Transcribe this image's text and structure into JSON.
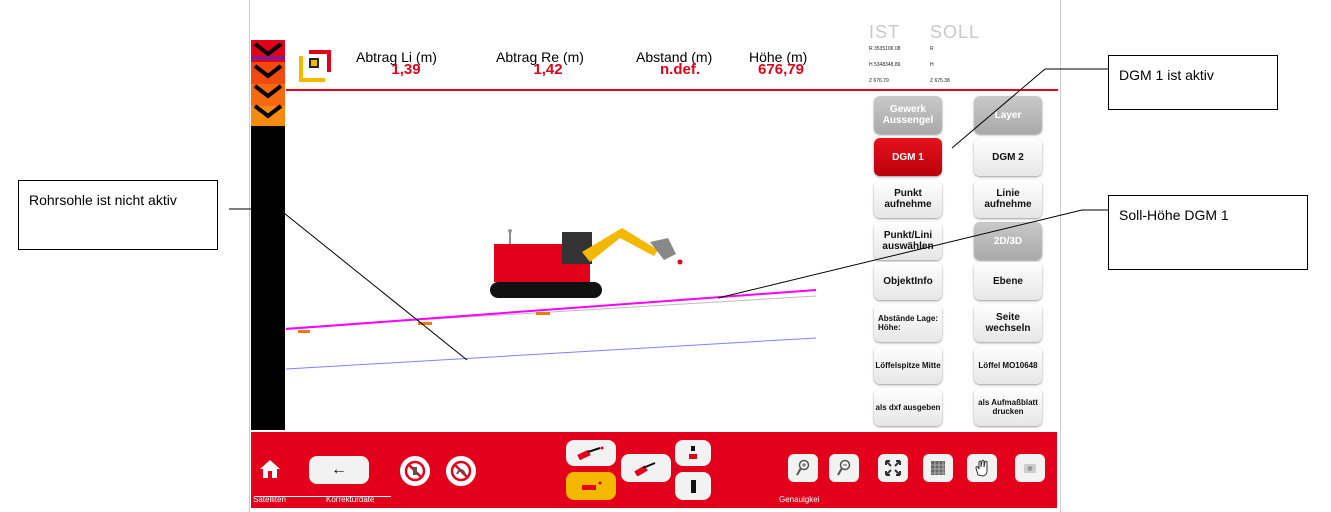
{
  "header": {
    "abtrag_li_label": "Abtrag Li (m)",
    "abtrag_li_value": "1,39",
    "abtrag_re_label": "Abtrag Re (m)",
    "abtrag_re_value": "1,42",
    "abstand_label": "Abstand (m)",
    "abstand_value": "n.def.",
    "hoehe_label": "Höhe (m)",
    "hoehe_value": "676,79"
  },
  "coords": {
    "ist_label": "IST",
    "soll_label": "SOLL",
    "ist_r": "R 3535106.08",
    "ist_h": "H 5348348.89",
    "ist_z": "Z 676.79",
    "soll_r": "R",
    "soll_h": "H",
    "soll_z": "Z 675.38"
  },
  "panel": {
    "gewerk": "Gewerk Aussengel",
    "layer": "Layer",
    "dgm1": "DGM 1",
    "dgm2": "DGM 2",
    "punkt_aufnehmen": "Punkt aufnehme",
    "linie_aufnehmen": "Linie aufnehme",
    "punkt_linie_auswaehlen": "Punkt/Lini auswählen",
    "view_2d3d": "2D/3D",
    "objektinfo": "ObjektInfo",
    "ebene": "Ebene",
    "abstaende": "Abstände Lage: Höhe:",
    "seite_wechseln": "Seite wechseln",
    "loeffelspitze": "Löffelspitze Mitte",
    "loeffel": "Löffel MO10648",
    "dxf": "als dxf ausgeben",
    "aufmassblatt": "als Aufmaßblatt drucken"
  },
  "status": {
    "satelliten": "Satelliten",
    "korrekturdaten": "Korrekturdate",
    "genauigkeit": "Genauigkei"
  },
  "toolbar": {
    "back_arrow": "←"
  },
  "callouts": {
    "rohrsohle": "Rohrsohle ist nicht aktiv",
    "dgm_aktiv": "DGM 1 ist aktiv",
    "soll_hoehe": "Soll-Höhe DGM 1"
  },
  "colors": {
    "accent_red": "#e3001b",
    "dgm_line": "#ff00ff",
    "rohrsohle_line": "#8080ff"
  },
  "icons": [
    "home-icon",
    "back-arrow-icon",
    "no-signal-icon",
    "no-correction-icon",
    "excavator-mode-icon",
    "zoom-in-icon",
    "zoom-out-icon",
    "fit-view-icon",
    "grid-icon",
    "pan-hand-icon",
    "screenshot-icon"
  ]
}
